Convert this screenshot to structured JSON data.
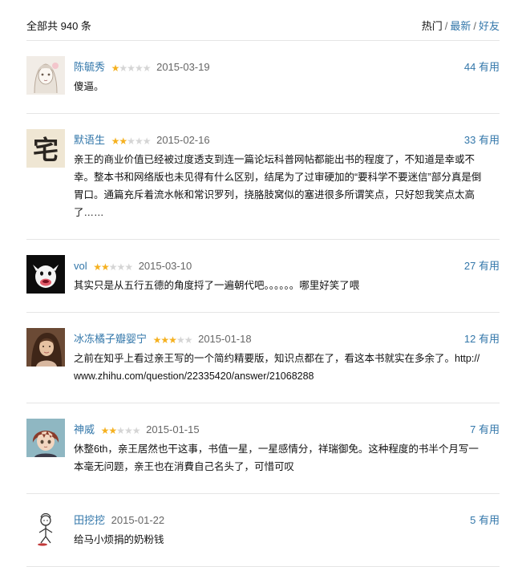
{
  "header": {
    "total": "全部共 940 条",
    "sort_hot": "热门",
    "sort_new": "最新",
    "sort_friends": "好友",
    "separator": "/"
  },
  "useful_label": "有用",
  "colors": {
    "link": "#3377aa",
    "star_on": "#f5b120",
    "star_off": "#d5d5d5",
    "divider": "#e5e5e5"
  },
  "comments": [
    {
      "user": "陈毓秀",
      "rating": 1,
      "time": "2015-03-19",
      "votes": "44",
      "text": "傻逼。",
      "avatar": "anime-girl-sketch-avatar"
    },
    {
      "user": "默语生",
      "rating": 2,
      "time": "2015-02-16",
      "votes": "33",
      "text": "亲王的商业价值已经被过度透支到连一篇论坛科普网帖都能出书的程度了，不知道是幸或不幸。整本书和网络版也未见得有什么区别，结尾为了过审硬加的“要科学不要迷信”部分真是倒胃口。通篇充斥着流水帐和常识罗列，挠胳肢窝似的塞进很多所谓笑点，只好恕我笑点太高了……",
      "avatar": "calligraphy-zhai-avatar"
    },
    {
      "user": "vol",
      "rating": 2,
      "time": "2015-03-10",
      "votes": "27",
      "text": "其实只是从五行五德的角度捋了一遍朝代吧。。。。。。哪里好笑了喂",
      "avatar": "cartoon-cow-avatar"
    },
    {
      "user": "冰冻橘子瓣婴宁",
      "rating": 3,
      "time": "2015-01-18",
      "votes": "12",
      "text": "之前在知乎上看过亲王写的一个简约精要版，知识点都在了，看这本书就实在多余了。http://www.zhihu.com/question/22335420/answer/21068288",
      "avatar": "portrait-woman-avatar"
    },
    {
      "user": "神威",
      "rating": 2,
      "time": "2015-01-15",
      "votes": "7",
      "text": "休整6th，亲王居然也干这事，书值一星，一星感情分，祥瑞御免。这种程度的书半个月写一本毫无问题，亲王也在消費自己名头了，可惜可叹",
      "avatar": "anime-boy-avatar"
    },
    {
      "user": "田挖挖",
      "rating": 0,
      "time": "2015-01-22",
      "votes": "5",
      "text": "给马小烦捐的奶粉钱",
      "avatar": "doodle-figure-avatar"
    }
  ]
}
